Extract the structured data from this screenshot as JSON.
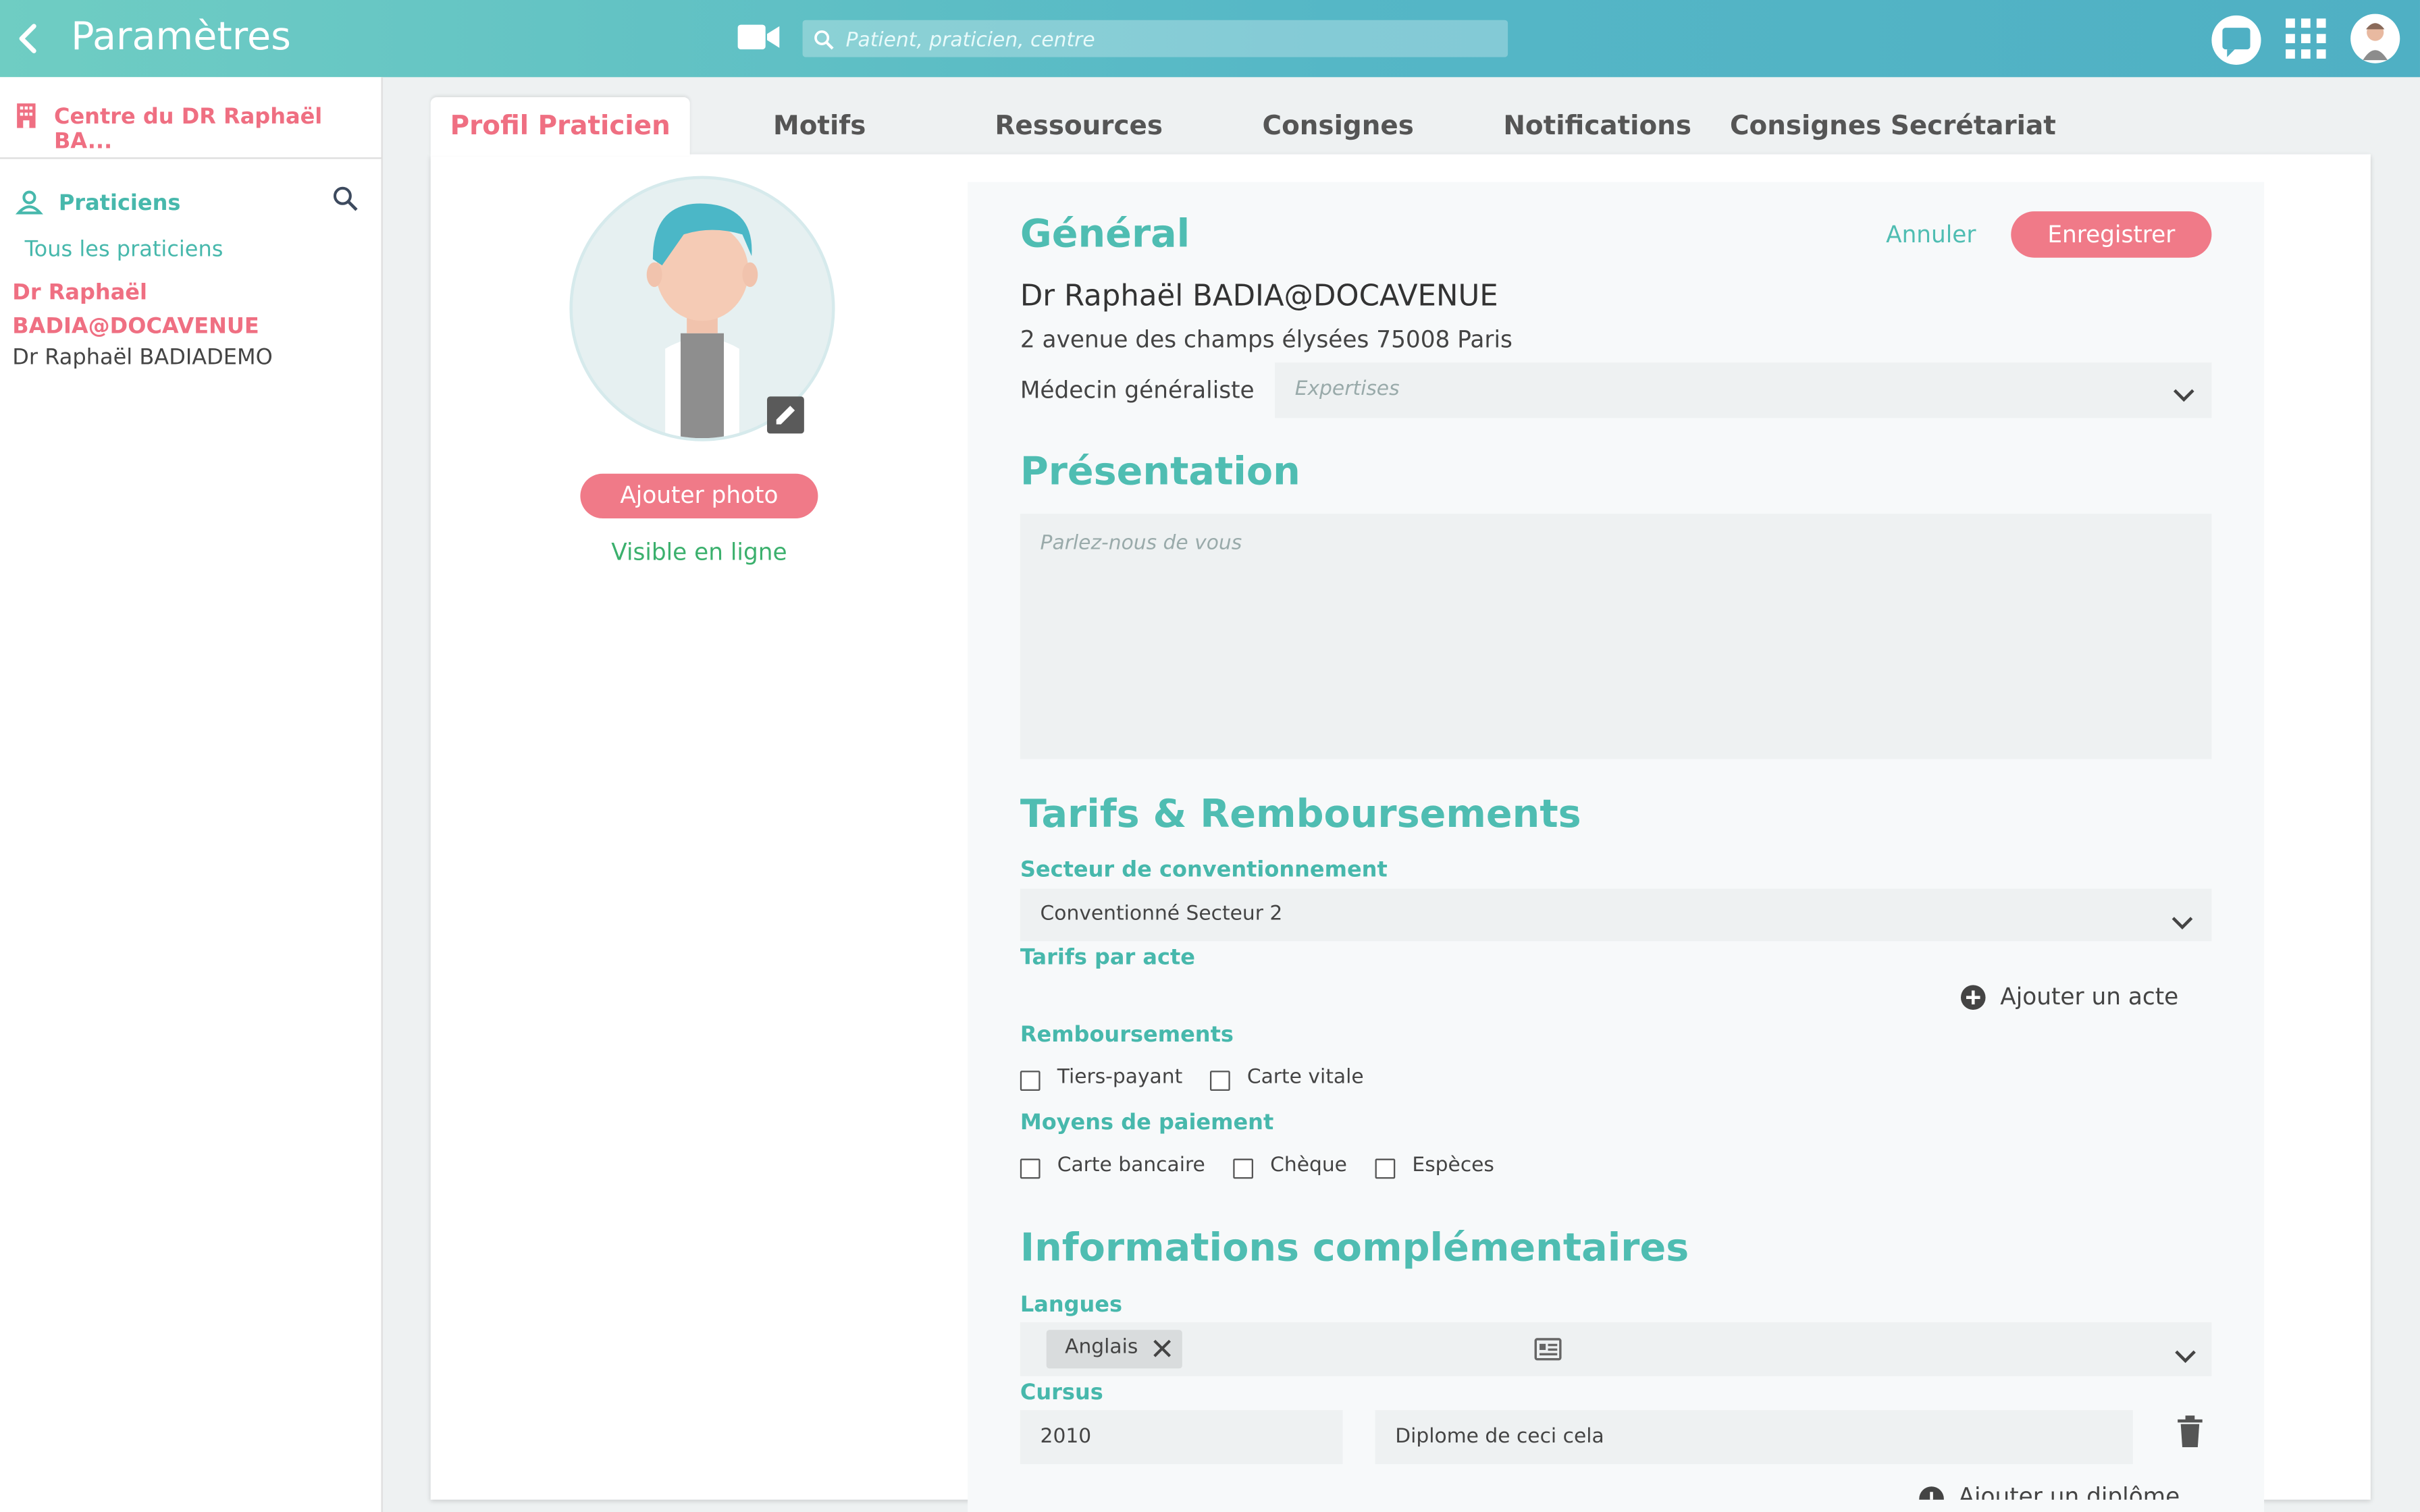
{
  "header": {
    "title": "Paramètres",
    "search_placeholder": "Patient, praticien, centre"
  },
  "sidebar": {
    "center": "Centre du DR Raphaël BA...",
    "section": "Praticiens",
    "all": "Tous les praticiens",
    "items": [
      "Dr Raphaël BADIA@DOCAVENUE",
      "Dr Raphaël BADIADEMO"
    ]
  },
  "tabs": [
    "Profil Praticien",
    "Motifs",
    "Ressources",
    "Consignes",
    "Notifications",
    "Consignes Secrétariat"
  ],
  "profile": {
    "add_photo": "Ajouter photo",
    "visible": "Visible en ligne"
  },
  "general": {
    "title": "Général",
    "cancel": "Annuler",
    "save": "Enregistrer",
    "name": "Dr Raphaël BADIA@DOCAVENUE",
    "address": "2 avenue des champs élysées 75008 Paris",
    "specialty": "Médecin généraliste",
    "expertise_placeholder": "Expertises"
  },
  "presentation": {
    "title": "Présentation",
    "placeholder": "Parlez-nous de vous"
  },
  "tarifs": {
    "title": "Tarifs & Remboursements",
    "sector_label": "Secteur de conventionnement",
    "sector_value": "Conventionné Secteur 2",
    "acts_label": "Tarifs par acte",
    "add_act": "Ajouter un acte",
    "reimb_label": "Remboursements",
    "reimb_options": [
      "Tiers-payant",
      "Carte vitale"
    ],
    "payment_label": "Moyens de paiement",
    "payment_options": [
      "Carte bancaire",
      "Chèque",
      "Espèces"
    ]
  },
  "info": {
    "title": "Informations complémentaires",
    "languages_label": "Langues",
    "languages": [
      "Anglais"
    ],
    "cursus_label": "Cursus",
    "cursus_year": "2010",
    "cursus_diploma": "Diplome de ceci cela",
    "add_diploma": "Ajouter un diplôme"
  },
  "colors": {
    "accent": "#4fbdb2",
    "brand_pink": "#f07a88",
    "header_start": "#6fcdc3",
    "header_end": "#4fb0c4"
  }
}
